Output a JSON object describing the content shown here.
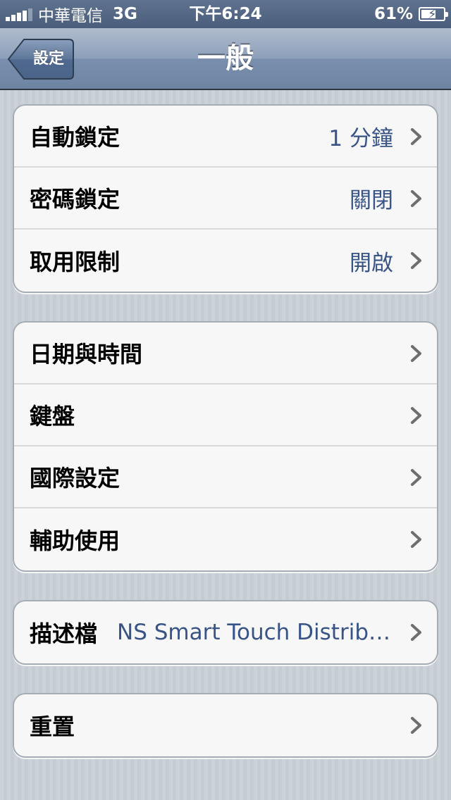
{
  "status_bar": {
    "carrier": "中華電信",
    "network": "3G",
    "time": "下午6:24",
    "battery": "61%"
  },
  "nav": {
    "back_label": "設定",
    "title": "一般"
  },
  "groups": [
    {
      "rows": [
        {
          "label": "自動鎖定",
          "value": "1 分鐘"
        },
        {
          "label": "密碼鎖定",
          "value": "關閉"
        },
        {
          "label": "取用限制",
          "value": "開啟"
        }
      ]
    },
    {
      "rows": [
        {
          "label": "日期與時間",
          "value": ""
        },
        {
          "label": "鍵盤",
          "value": ""
        },
        {
          "label": "國際設定",
          "value": ""
        },
        {
          "label": "輔助使用",
          "value": ""
        }
      ]
    },
    {
      "rows": [
        {
          "label": "描述檔",
          "value": "NS Smart Touch Distrib…"
        }
      ]
    },
    {
      "rows": [
        {
          "label": "重置",
          "value": ""
        }
      ]
    }
  ],
  "icons": {
    "chevron": "chevron-right-icon",
    "signal": "signal-bars-icon",
    "battery": "battery-charging-icon"
  },
  "colors": {
    "value_text": "#385487",
    "nav_bar": "#6d84a2"
  }
}
